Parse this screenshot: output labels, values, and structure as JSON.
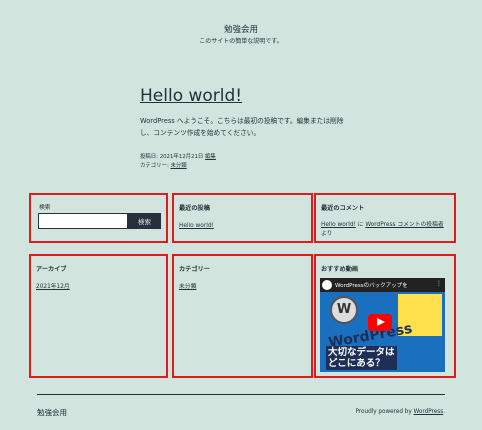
{
  "site": {
    "title": "勉強会用",
    "description": "このサイトの簡単な説明です。"
  },
  "post": {
    "title": "Hello world!",
    "body": "WordPress へようこそ。こちらは最初の投稿です。編集または削除し、コンテンツ作成を始めてください。",
    "date_label": "投稿日: 2021年12月21日",
    "edit_link": "編集",
    "category_label": "カテゴリー:",
    "category_link": "未分類"
  },
  "widgets": {
    "search": {
      "label": "検索",
      "value": "",
      "button": "検索"
    },
    "recent_posts": {
      "title": "最近の投稿",
      "items": [
        "Hello world!"
      ]
    },
    "recent_comments": {
      "title": "最近のコメント",
      "post_link": "Hello world!",
      "connector": "に",
      "author_link": "WordPress コメントの投稿者",
      "suffix": "より"
    },
    "archives": {
      "title": "アーカイブ",
      "items": [
        "2021年12月"
      ]
    },
    "categories": {
      "title": "カテゴリー",
      "items": [
        "未分類"
      ]
    },
    "video": {
      "title": "おすすめ動画",
      "caption": "WordPressのバックアップを",
      "menu": "⋮",
      "logo_letter": "W",
      "thumb_word": "WordPress",
      "thumb_question": "大切なデータは\nどこにある？"
    }
  },
  "footer": {
    "site_title": "勉強会用",
    "powered_prefix": "Proudly powered by ",
    "powered_link": "WordPress",
    "powered_suffix": "."
  },
  "colors": {
    "background": "#d1e4dd",
    "text": "#28303d",
    "widget_border": "#e01b1b"
  }
}
